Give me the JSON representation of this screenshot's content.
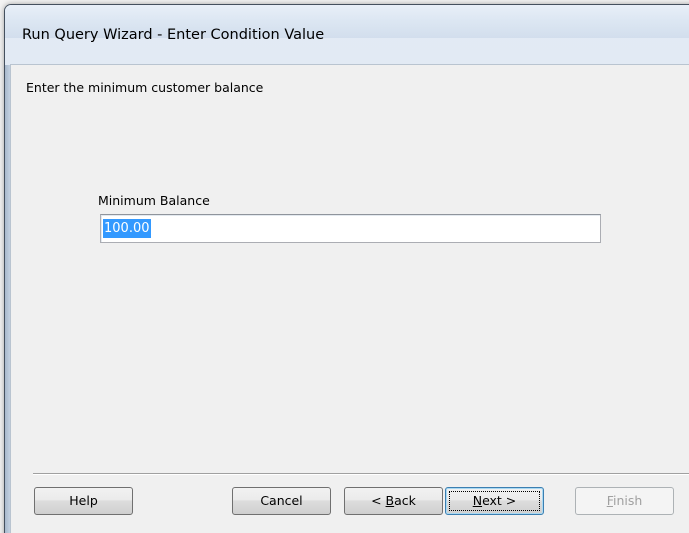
{
  "window": {
    "title": "Run Query Wizard - Enter Condition Value"
  },
  "content": {
    "instruction": "Enter the minimum customer balance",
    "field_label": "Minimum Balance",
    "field_value": "100.00"
  },
  "buttons": {
    "help": "Help",
    "cancel": "Cancel",
    "back": {
      "prefix": "< ",
      "mnemonic": "B",
      "rest": "ack"
    },
    "next": {
      "mnemonic": "N",
      "rest": "ext >"
    },
    "finish": {
      "mnemonic": "F",
      "rest": "inish"
    }
  },
  "colors": {
    "selection": "#3399ff",
    "default_button_border": "#3c7fb1"
  }
}
